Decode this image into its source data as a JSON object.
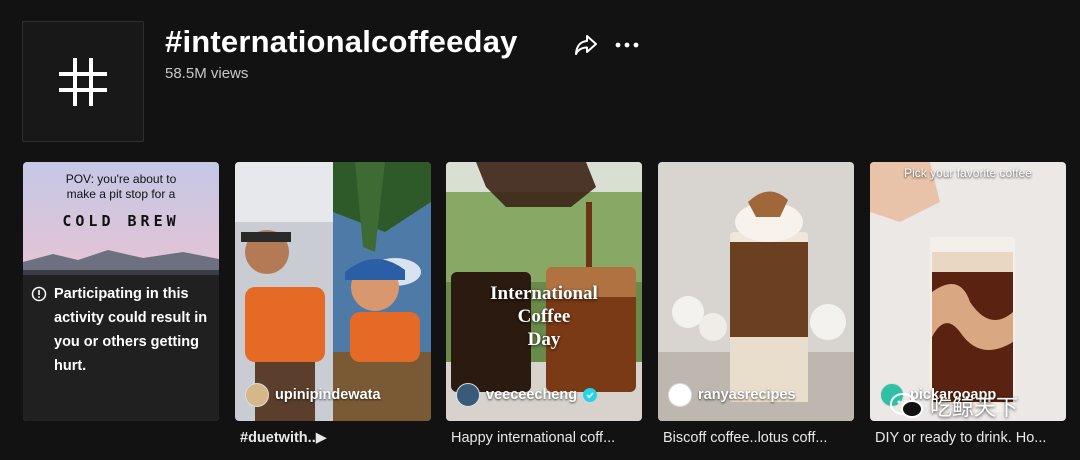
{
  "header": {
    "title": "#internationalcoffeeday",
    "views": "58.5M views",
    "tag_icon": "hashtag-icon",
    "share_icon": "share-icon",
    "more_icon": "more-icon"
  },
  "videos": [
    {
      "pov_line1": "POV: you're about to",
      "pov_line2": "make a pit stop for a",
      "overlay_title": "COLD BREW",
      "warning": "Participating in this activity could result in you or others getting hurt.",
      "warning_icon": "info-icon",
      "caption": ""
    },
    {
      "username": "upinipindewata",
      "caption": "#duetwith..▶"
    },
    {
      "username": "veeceecheng",
      "verified": true,
      "overlay_line1": "International",
      "overlay_line2": "Coffee",
      "overlay_line3": "Day",
      "caption": "Happy international coff..."
    },
    {
      "username": "ranyasrecipes",
      "caption": "Biscoff coffee..lotus coff..."
    },
    {
      "username": "pickarooapp",
      "overlay_top": "Pick your favorite coffee",
      "caption": "DIY or ready to drink. Ho..."
    }
  ],
  "watermark": "吃鲸天下",
  "colors": {
    "background": "#121212",
    "verified": "#20d5ec"
  }
}
